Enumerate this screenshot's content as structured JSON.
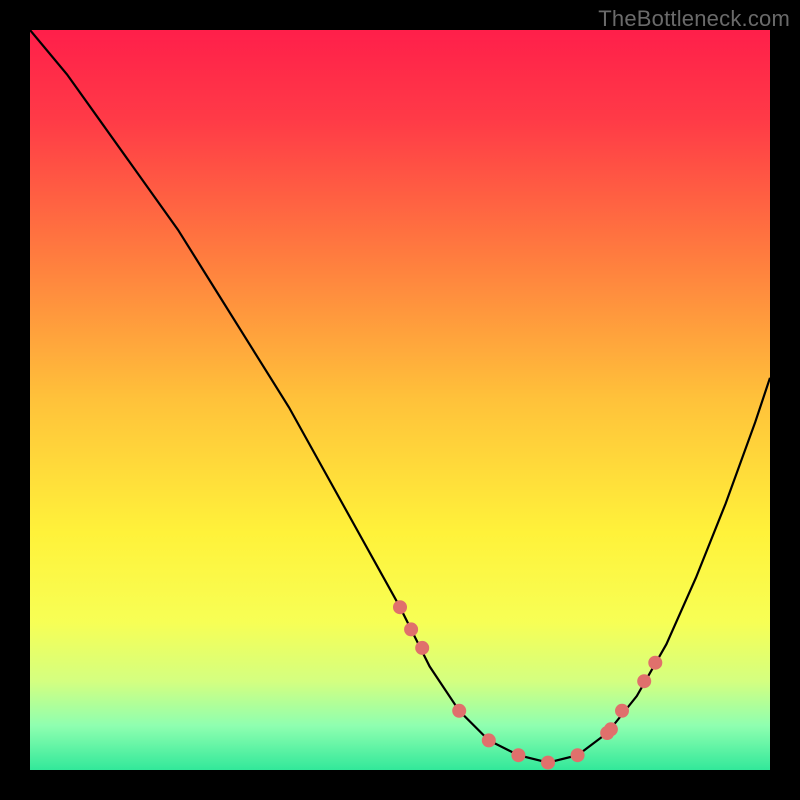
{
  "watermark": "TheBottleneck.com",
  "chart_data": {
    "type": "line",
    "title": "",
    "xlabel": "",
    "ylabel": "",
    "xlim": [
      0,
      100
    ],
    "ylim": [
      0,
      100
    ],
    "curve": {
      "x": [
        0,
        5,
        10,
        15,
        20,
        25,
        30,
        35,
        40,
        45,
        50,
        54,
        58,
        62,
        66,
        70,
        74,
        78,
        82,
        86,
        90,
        94,
        98,
        100
      ],
      "y": [
        100,
        94,
        87,
        80,
        73,
        65,
        57,
        49,
        40,
        31,
        22,
        14,
        8,
        4,
        2,
        1,
        2,
        5,
        10,
        17,
        26,
        36,
        47,
        53
      ]
    },
    "markers": {
      "x": [
        50,
        51.5,
        53,
        58,
        62,
        66,
        70,
        74,
        78,
        78.5,
        80,
        83,
        84.5
      ],
      "y": [
        22,
        19,
        16.5,
        8,
        4,
        2,
        1,
        2,
        5,
        5.5,
        8,
        12,
        14.5
      ]
    },
    "marker_color": "#e0706c",
    "curve_color": "#000000",
    "gradient_stops": [
      {
        "offset": 0,
        "color": "#ff1f4a"
      },
      {
        "offset": 0.12,
        "color": "#ff3a47"
      },
      {
        "offset": 0.3,
        "color": "#ff7a3f"
      },
      {
        "offset": 0.5,
        "color": "#ffc23a"
      },
      {
        "offset": 0.68,
        "color": "#fff23a"
      },
      {
        "offset": 0.8,
        "color": "#f7ff55"
      },
      {
        "offset": 0.88,
        "color": "#d4ff80"
      },
      {
        "offset": 0.94,
        "color": "#8fffb0"
      },
      {
        "offset": 1.0,
        "color": "#32e89a"
      }
    ]
  }
}
